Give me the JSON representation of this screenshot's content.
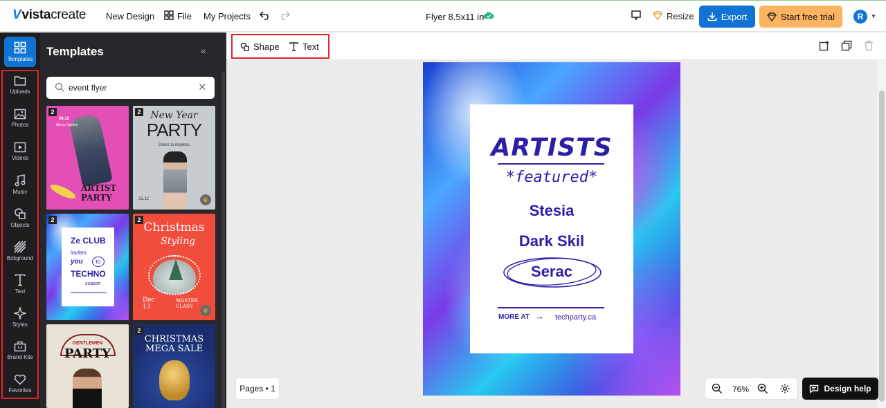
{
  "app": {
    "logo_prefix": "vista",
    "logo_suffix": "create",
    "menu": [
      "New Design",
      "File",
      "My Projects"
    ],
    "doc_title": "Flyer 8.5x11 in",
    "resize_label": "Resize",
    "export_label": "Export",
    "trial_label": "Start free trial",
    "avatar_initial": "R"
  },
  "rail": {
    "items": [
      "Templates",
      "Uploads",
      "Photos",
      "Videos",
      "Music",
      "Objects",
      "Bckground",
      "Text",
      "Styles",
      "Brand Kits",
      "Favorites"
    ]
  },
  "panel": {
    "title": "Templates",
    "search_value": "event flyer",
    "thumbs": [
      {
        "badge": "2",
        "t1": "ARTIST",
        "t2": "PARTY",
        "small1": "08.12",
        "small2": "Mercy Garden"
      },
      {
        "badge": "2",
        "t1": "New Year",
        "t2": "PARTY",
        "small1": "Dress to impress",
        "small2": "31.12"
      },
      {
        "badge": "2",
        "t1": "Ze CLUB",
        "t2": "invites",
        "t3": "you",
        "t4": "to",
        "t5": "TECHNO",
        "t6": "season"
      },
      {
        "badge": "2",
        "t1": "Christmas",
        "t2": "Styling",
        "small1": "Dec 13",
        "small2": "MASTER CLASS"
      },
      {
        "badge": "",
        "t1": "GENTLEMEN",
        "t2": "PARTY"
      },
      {
        "badge": "2",
        "t1": "CHRISTMAS",
        "t2": "MEGA SALE"
      }
    ]
  },
  "toolbar": {
    "shape_label": "Shape",
    "text_label": "Text"
  },
  "canvas": {
    "title": "ARTISTS",
    "subtitle": "*featured*",
    "artists": [
      "Stesia",
      "Dark Skil",
      "Serac"
    ],
    "more_at": "MORE AT",
    "arrow": "→",
    "url": "techparty.ca"
  },
  "bottom": {
    "pages_label": "Pages • 1",
    "zoom": "76%",
    "help_label": "Design help"
  },
  "colors": {
    "accent": "#1173d4",
    "trial": "#fdb462",
    "highlight": "#e0242a",
    "flyer_text": "#2b1fa8"
  }
}
